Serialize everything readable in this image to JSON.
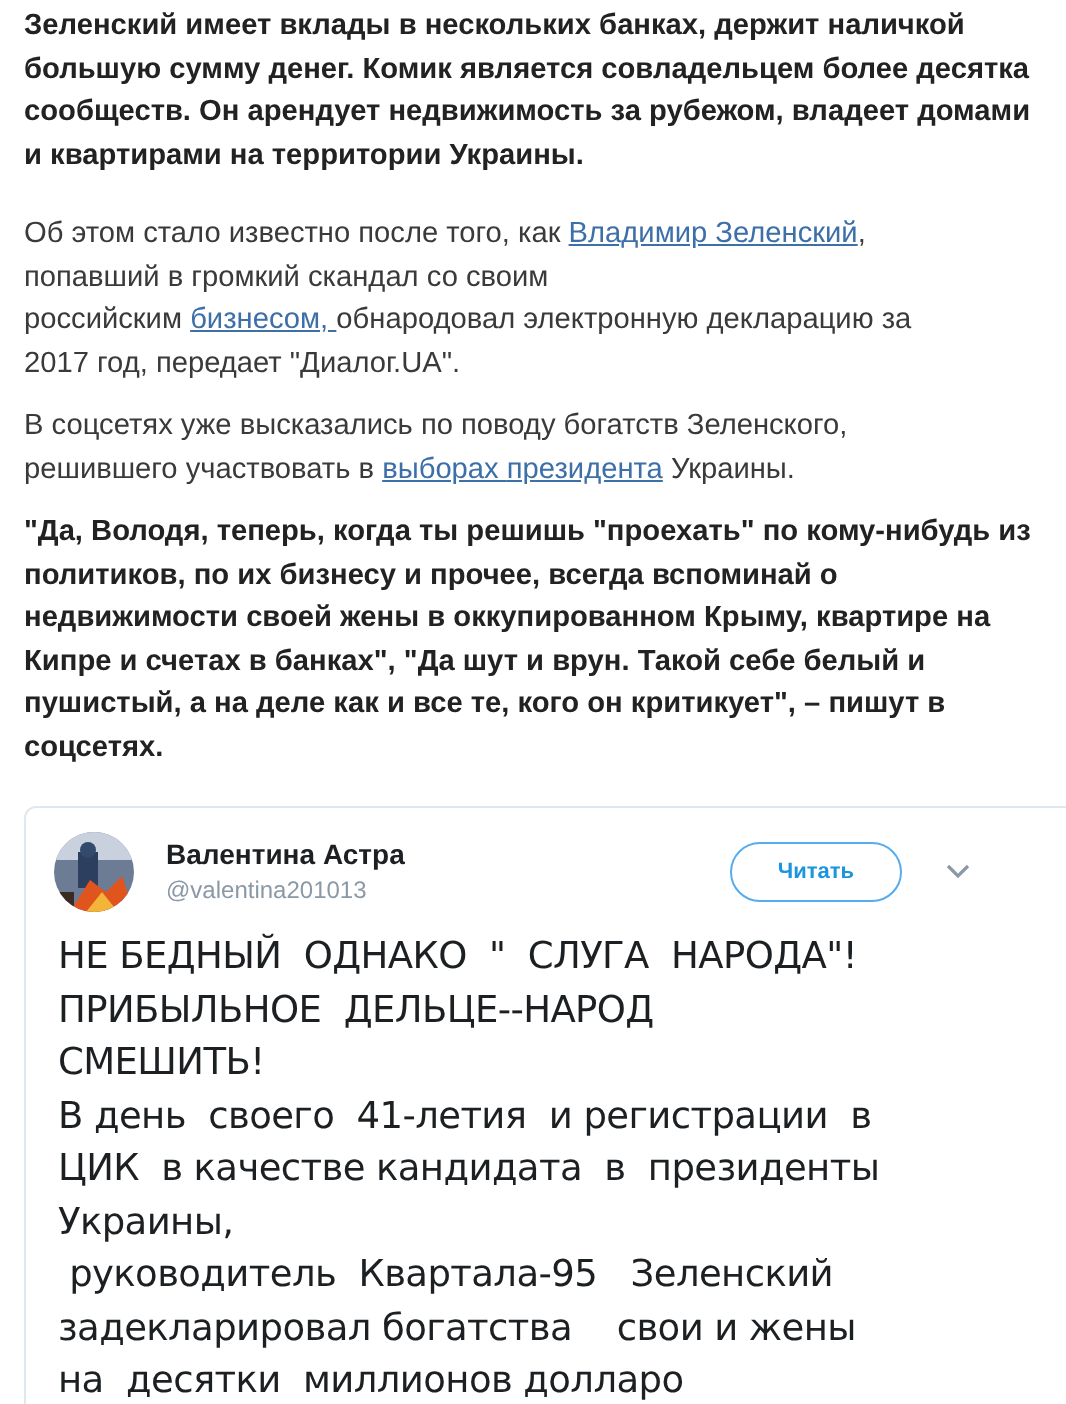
{
  "article": [
    {
      "kind": "bold",
      "parts": [
        {
          "text": "Зеленский имеет вклады в нескольких банках, держит наличкой\nбольшую сумму денег. Комик является совладельцем более десятка\nсообществ. Он арендует недвижимость за рубежом, владеет домами\nи квартирами на территории Украины.",
          "link": false
        }
      ]
    },
    {
      "kind": "plain",
      "parts": [
        {
          "text": "Об этом стало известно после того, как ",
          "link": false
        },
        {
          "text": "Владимир Зеленский",
          "link": true
        },
        {
          "text": ",\nпопавший в громкий скандал со своим\nроссийским ",
          "link": false
        },
        {
          "text": "бизнесом, ",
          "link": true
        },
        {
          "text": "обнародовал электронную декларацию за\n2017 год, передает \"Диалог.UA\".",
          "link": false
        }
      ]
    },
    {
      "kind": "plain",
      "parts": [
        {
          "text": "В соцсетях уже высказались по поводу богатств Зеленского,\nрешившего участвовать в ",
          "link": false
        },
        {
          "text": "выборах ",
          "link": true
        },
        {
          "text": "президента",
          "link": true
        },
        {
          "text": " Украины.",
          "link": false
        }
      ]
    },
    {
      "kind": "bold",
      "parts": [
        {
          "text": "\"Да, Володя, теперь, когда ты решишь \"проехать\" по кому-нибудь из\nполитиков, по их бизнесу и прочее, всегда вспоминай о\nнедвижимости своей жены в оккупированном Крыму, квартире на\nКипре и счетах в банках\", \"Да шут и врун. Такой себе белый и\nпушистый, а на деле как и все те, кого он критикует\", – пишут в\nсоцсетях.",
          "link": false
        }
      ]
    }
  ],
  "tweet": {
    "name": "Валентина Астра",
    "handle": "@valentina201013",
    "follow_button": "Читать",
    "text": "НЕ БЕДНЫЙ  ОДНАКО  \"  СЛУГА  НАРОДА\"!\nПРИБЫЛЬНОЕ  ДЕЛЬЦЕ--НАРОД\nСМЕШИТЬ!\nВ день  своего  41-летия  и регистрации  в\nЦИК  в качестве кандидата  в  президенты\nУкраины,\n руководитель  Квартала-95   Зеленский\nзадекларировал богатства    свои и жены\nна  десятки  миллионов долларо"
  }
}
